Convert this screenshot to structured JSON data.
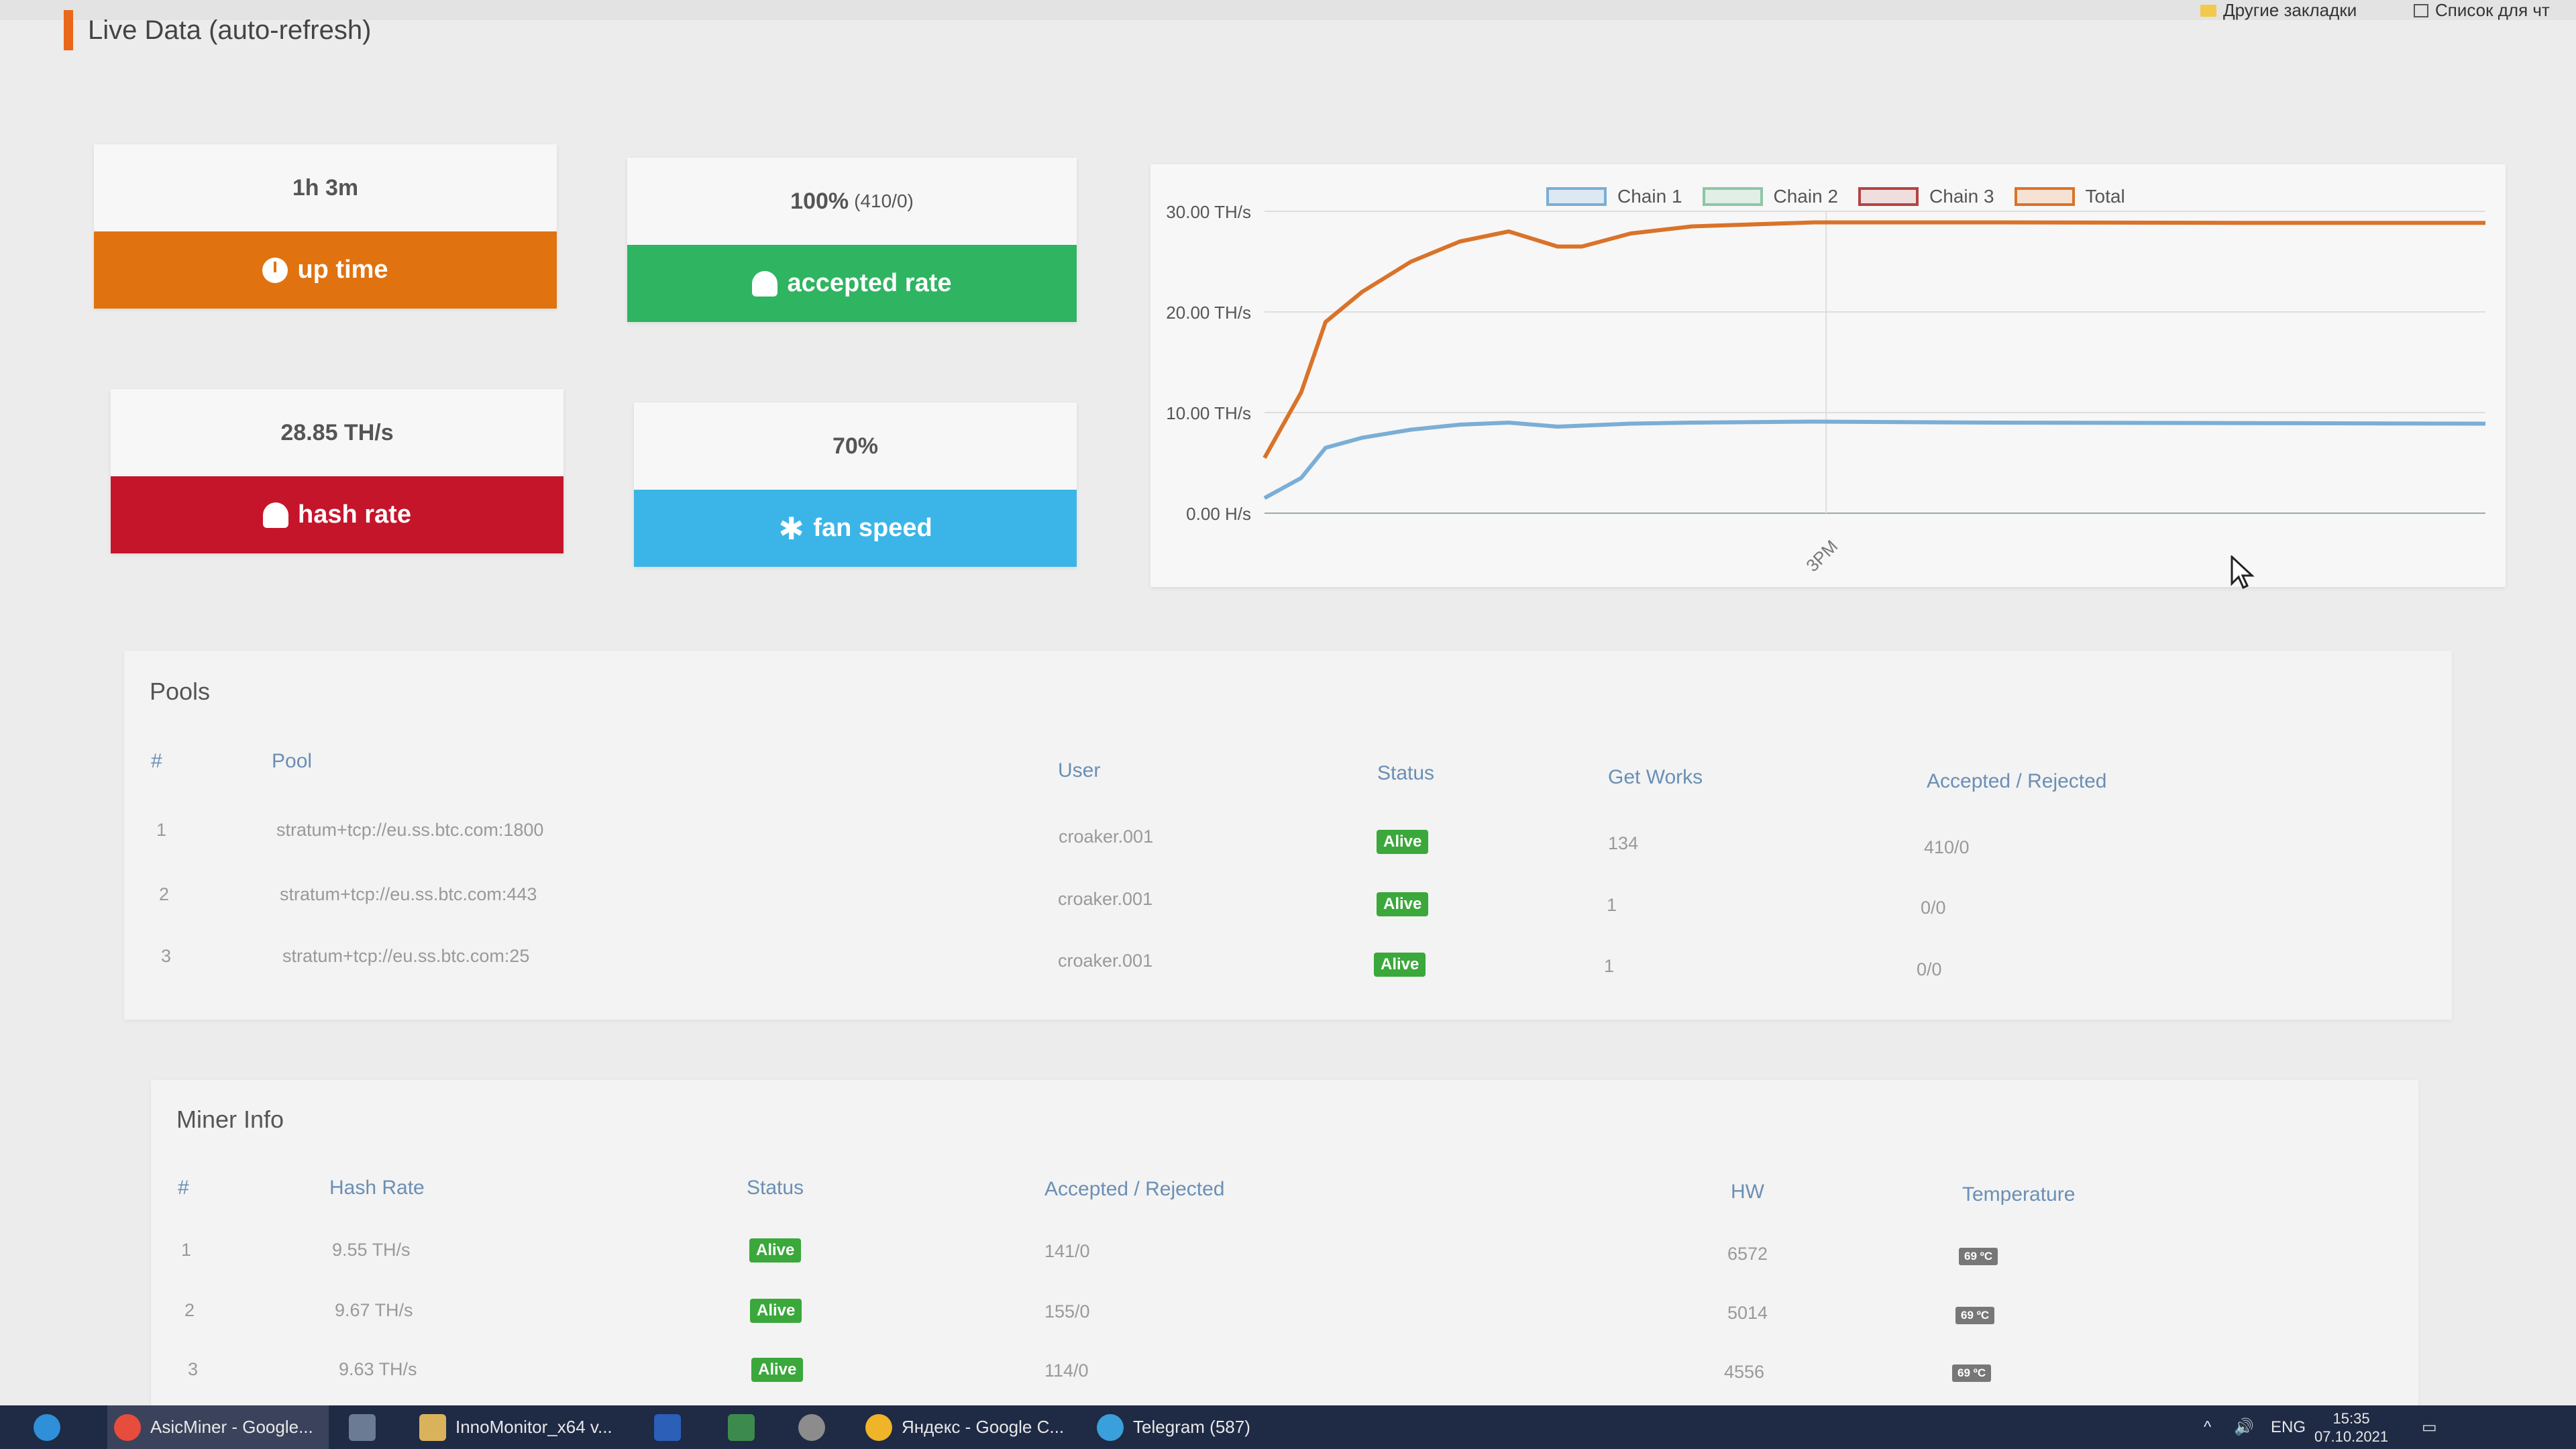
{
  "browser": {
    "bookmark_folder_1": "Другие закладки",
    "bookmark_folder_2": "Список для чт"
  },
  "page": {
    "title": "Live Data (auto-refresh)"
  },
  "stats": {
    "uptime": {
      "value": "1h 3m",
      "label": "up time",
      "icon": "clock-icon"
    },
    "accepted": {
      "value": "100%",
      "value_sub": "(410/0)",
      "label": "accepted rate",
      "icon": "gauge-icon"
    },
    "hashrate": {
      "value": "28.85 TH/s",
      "label": "hash rate",
      "icon": "gauge-icon"
    },
    "fan": {
      "value": "70%",
      "label": "fan speed",
      "icon": "fan-icon"
    }
  },
  "colors": {
    "uptime": "#e07210",
    "accepted": "#2fb461",
    "hashrate": "#c5152b",
    "fan": "#3bb5e8",
    "chain1": "#7aaed6",
    "chain2": "#8fc5a6",
    "chain3": "#b44444",
    "total": "#d9732a"
  },
  "chart_data": {
    "type": "line",
    "y_tick_labels": [
      "30.00 TH/s",
      "20.00 TH/s",
      "10.00 TH/s",
      "0.00 H/s"
    ],
    "ylim": [
      0,
      30
    ],
    "x_tick_labels": [
      "3PM"
    ],
    "legend": {
      "position": "top",
      "entries": [
        "Chain 1",
        "Chain 2",
        "Chain 3",
        "Total"
      ]
    },
    "x": [
      0,
      0.03,
      0.05,
      0.08,
      0.12,
      0.16,
      0.2,
      0.24,
      0.26,
      0.3,
      0.35,
      0.45,
      0.6,
      0.8,
      1.0
    ],
    "series": [
      {
        "name": "Total",
        "values": [
          5.5,
          12,
          19,
          22,
          25,
          27,
          28,
          26.5,
          26.5,
          27.8,
          28.5,
          28.9,
          28.9,
          28.85,
          28.85
        ]
      },
      {
        "name": "Chain 1",
        "values": [
          1.5,
          3.5,
          6.5,
          7.5,
          8.3,
          8.8,
          9,
          8.6,
          8.7,
          8.9,
          9,
          9.1,
          9,
          8.95,
          8.9
        ]
      }
    ]
  },
  "pools": {
    "title": "Pools",
    "columns": [
      "#",
      "Pool",
      "User",
      "Status",
      "Get Works",
      "Accepted / Rejected"
    ],
    "rows": [
      {
        "n": "1",
        "pool": "stratum+tcp://eu.ss.btc.com:1800",
        "user": "croaker.001",
        "status": "Alive",
        "works": "134",
        "ar": "410/0"
      },
      {
        "n": "2",
        "pool": "stratum+tcp://eu.ss.btc.com:443",
        "user": "croaker.001",
        "status": "Alive",
        "works": "1",
        "ar": "0/0"
      },
      {
        "n": "3",
        "pool": "stratum+tcp://eu.ss.btc.com:25",
        "user": "croaker.001",
        "status": "Alive",
        "works": "1",
        "ar": "0/0"
      }
    ]
  },
  "miner": {
    "title": "Miner Info",
    "columns": [
      "#",
      "Hash Rate",
      "Status",
      "Accepted / Rejected",
      "HW",
      "Temperature"
    ],
    "rows": [
      {
        "n": "1",
        "rate": "9.55 TH/s",
        "status": "Alive",
        "ar": "141/0",
        "hw": "6572",
        "temp": "69 ºC"
      },
      {
        "n": "2",
        "rate": "9.67 TH/s",
        "status": "Alive",
        "ar": "155/0",
        "hw": "5014",
        "temp": "69 ºC"
      },
      {
        "n": "3",
        "rate": "9.63 TH/s",
        "status": "Alive",
        "ar": "114/0",
        "hw": "4556",
        "temp": "69 ºC"
      }
    ]
  },
  "taskbar": {
    "items": [
      "AsicMiner - Google...",
      "InnoMonitor_x64 v...",
      "Яндекс - Google C...",
      "Telegram (587)"
    ],
    "telegram_badge": "587",
    "lang": "ENG",
    "time": "15:35",
    "date": "07.10.2021"
  }
}
